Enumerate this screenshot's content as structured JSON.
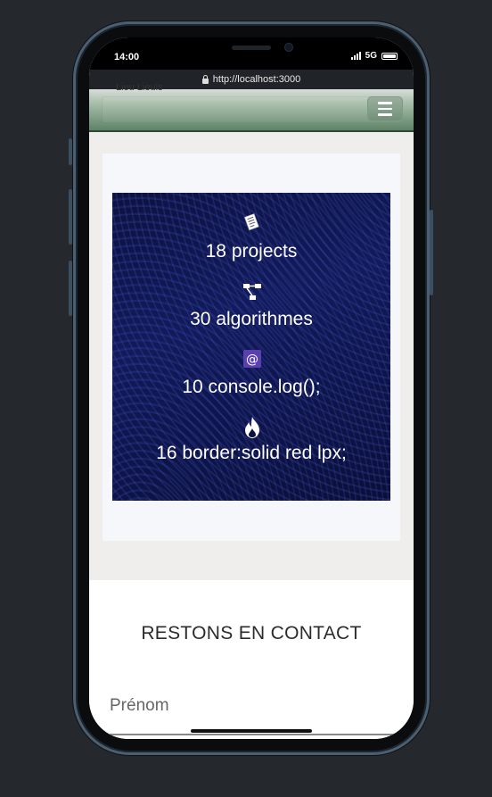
{
  "status_bar": {
    "time": "14:00",
    "network": "5G"
  },
  "browser": {
    "url": "http://localhost:3000"
  },
  "navbar": {
    "brand_partial": "Lieu Lieuls",
    "menu_icon": "hamburger-icon"
  },
  "stats": [
    {
      "icon": "document-icon",
      "text": "18 projects"
    },
    {
      "icon": "flowchart-icon",
      "text": "30 algorithmes"
    },
    {
      "icon": "at-sign-icon",
      "text": "10 console.log();"
    },
    {
      "icon": "fire-icon",
      "text": "16 border:solid red lpx;"
    }
  ],
  "contact": {
    "title": "RESTONS EN CONTACT",
    "first_name_label": "Prénom"
  },
  "colors": {
    "accent": "#5e8367",
    "stats_bg": "#0d1240",
    "at_badge": "#5a3fb0"
  }
}
